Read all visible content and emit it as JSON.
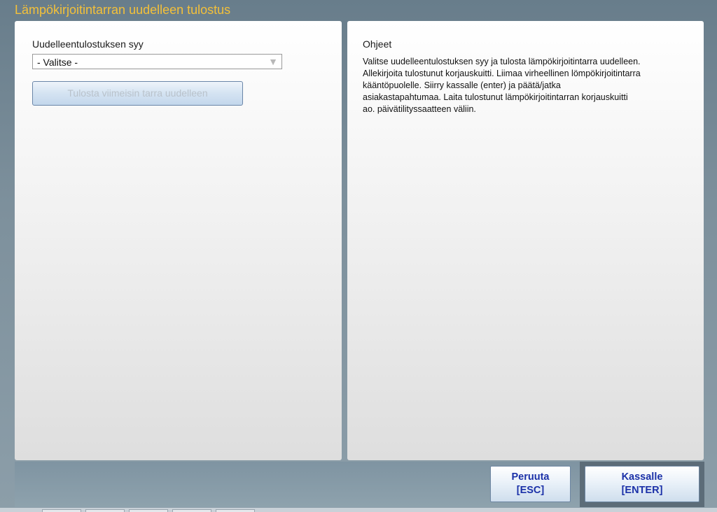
{
  "window": {
    "title": "Lämpökirjoitintarran uudelleen tulostus"
  },
  "left": {
    "reason_label": "Uudelleentulostuksen syy",
    "reason_select": {
      "selected": "- Valitse -",
      "arrow": "▼"
    },
    "print_button": "Tulosta viimeisin tarra uudelleen"
  },
  "help": {
    "heading": "Ohjeet",
    "lines": [
      "Valitse uudelleentulostuksen syy ja tulosta lämpökirjoitintarra uudelleen.",
      "Allekirjoita tulostunut korjauskuitti. Liimaa virheellinen lömpökirjoitintarra",
      "kääntöpuolelle. Siirry kassalle (enter) ja päätä/jatka",
      "asiakastapahtumaa. Laita tulostunut lämpökirjoitintarran korjauskuitti",
      "ao. päivätilityssaatteen väliin."
    ]
  },
  "footer": {
    "cancel": {
      "label": "Peruuta",
      "key": "[ESC]"
    },
    "enter": {
      "label": "Kassalle",
      "key": "[ENTER]"
    }
  },
  "colors": {
    "title": "#f3c03a",
    "button_text": "#1b31a8",
    "disabled_text": "#b9c2cb"
  },
  "icons": {
    "dropdown": "chevron-down-icon"
  }
}
